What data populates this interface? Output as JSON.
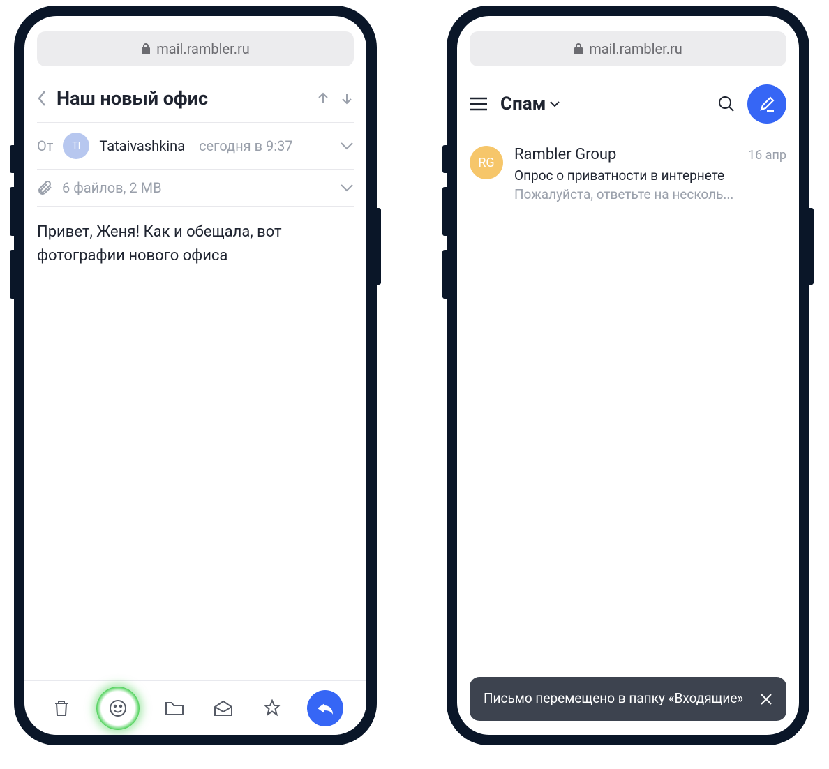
{
  "url": "mail.rambler.ru",
  "left": {
    "subject": "Наш новый офис",
    "from_label": "От",
    "avatar_initials": "TI",
    "sender_name": "Tataivashkina",
    "sender_date": "сегодня в 9:37",
    "attachments_text": "6 файлов, 2 MB",
    "body": "Привет, Женя! Как и обещала, вот фотографии нового офиса"
  },
  "right": {
    "folder": "Спам",
    "item": {
      "avatar_initials": "RG",
      "sender": "Rambler Group",
      "date": "16 апр",
      "subject": "Опрос о приватности в интернете",
      "preview": "Пожалуйста, ответьте на несколь..."
    },
    "toast": "Письмо перемещено в папку «Входящие»"
  }
}
